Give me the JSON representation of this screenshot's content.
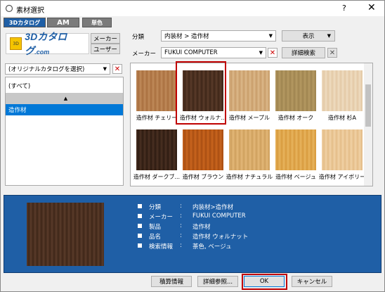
{
  "window": {
    "title": "素材選択",
    "help": "?",
    "close": "✕"
  },
  "tabs": [
    "3Dカタログ",
    "AM",
    "単色"
  ],
  "logo": {
    "mark": "3D",
    "text_main": "3Dカタログ",
    "text_suffix": ".com"
  },
  "buttons": {
    "maker": "メーカー",
    "user": "ユーザー",
    "display": "表示",
    "detail_search": "詳細検索",
    "estimate": "積算情報",
    "detail_ref": "詳細参照...",
    "ok": "OK",
    "cancel": "キャンセル"
  },
  "filters": {
    "category_label": "分類",
    "category_value": "内装材 > 造作材",
    "maker_label": "メーカー",
    "maker_value": "FUKUI COMPUTER",
    "catalog_value": "(オリジナルカタログを選択)"
  },
  "left_list": [
    "(すべて)",
    "",
    "造作材"
  ],
  "materials": [
    {
      "name": "造作材 チェリー",
      "color_a": "#c08a5a",
      "color_b": "#a9703f"
    },
    {
      "name": "造作材 ウォルナ...",
      "color_a": "#5a3b2a",
      "color_b": "#3e2618"
    },
    {
      "name": "造作材 メープル",
      "color_a": "#dcb88a",
      "color_b": "#c99d6a"
    },
    {
      "name": "造作材 オーク",
      "color_a": "#b59a62",
      "color_b": "#9f8450"
    },
    {
      "name": "造作材 杉A",
      "color_a": "#efdcc0",
      "color_b": "#e3c9a6"
    },
    {
      "name": "造作材 ダークブ...",
      "color_a": "#4a3022",
      "color_b": "#2e1c12"
    },
    {
      "name": "造作材 ブラウン",
      "color_a": "#c9651e",
      "color_b": "#a94e12"
    },
    {
      "name": "造作材 ナチュラル",
      "color_a": "#e3b878",
      "color_b": "#cfa05e"
    },
    {
      "name": "造作材 ベージュ",
      "color_a": "#e8b45e",
      "color_b": "#d89b3e"
    },
    {
      "name": "造作材 アイボリー",
      "color_a": "#f1d2a6",
      "color_b": "#e4bd88"
    }
  ],
  "details": [
    {
      "label": "分類",
      "value": "内装材>造作材"
    },
    {
      "label": "メーカー",
      "value": "FUKUI COMPUTER"
    },
    {
      "label": "製品",
      "value": "造作材"
    },
    {
      "label": "品名",
      "value": "造作材 ウォルナット"
    },
    {
      "label": "検索情報",
      "value": "茶色, ベージュ"
    }
  ],
  "detail_separator": ":",
  "selected_swatch": {
    "color_a": "#5a3b2a",
    "color_b": "#3e2618"
  },
  "accent": "#1f5fa6",
  "highlight": "#c00000"
}
